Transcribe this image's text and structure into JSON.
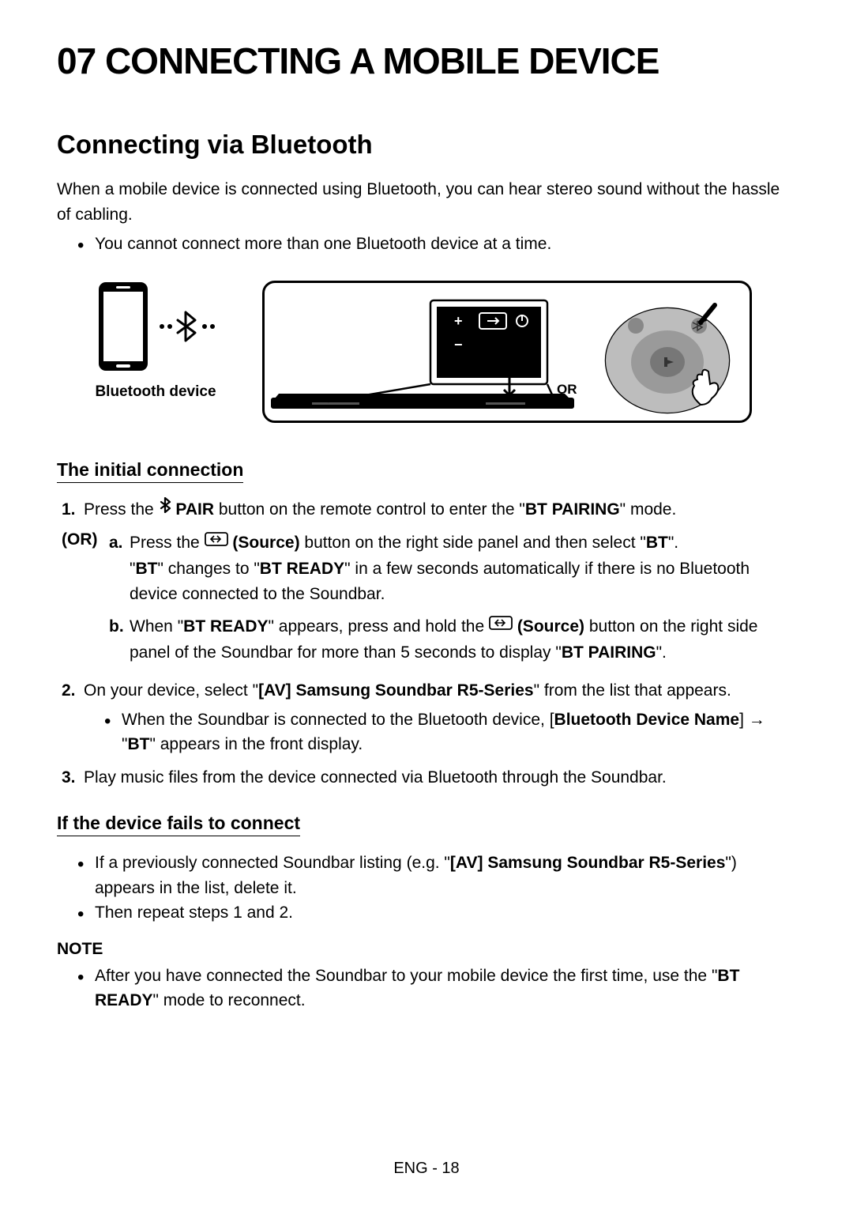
{
  "chapter": "07   CONNECTING A MOBILE DEVICE",
  "section": "Connecting via Bluetooth",
  "intro": "When a mobile device is connected using Bluetooth, you can hear stereo sound without the hassle of cabling.",
  "introBullet": "You cannot connect more than one Bluetooth device at a time.",
  "phoneLabel": "Bluetooth device",
  "orLabelDiagram": "OR",
  "initialConn": "The initial connection",
  "step1_a": "Press the ",
  "step1_pair": " PAIR",
  "step1_b": " button on the remote control to enter the \"",
  "step1_bold": "BT PAIRING",
  "step1_c": "\" mode.",
  "orLabel": "(OR)",
  "subA_1": "Press the ",
  "subA_src": " (Source)",
  "subA_2": " button on the right side panel and then select \"",
  "subA_bt": "BT",
  "subA_3": "\".",
  "subA_line2a": "\"",
  "subA_line2b": "BT",
  "subA_line2c": "\" changes to \"",
  "subA_line2d": "BT READY",
  "subA_line2e": "\" in a few seconds automatically if there is no Bluetooth device connected to the Soundbar.",
  "subB_1": "When \"",
  "subB_2": "BT READY",
  "subB_3": "\" appears, press and hold the ",
  "subB_src": " (Source)",
  "subB_4": " button on the right side panel of the Soundbar for more than 5 seconds to display \"",
  "subB_5": "BT PAIRING",
  "subB_6": "\".",
  "step2_a": "On your device, select \"",
  "step2_b": "[AV] Samsung Soundbar R5-Series",
  "step2_c": "\" from the list that appears.",
  "step2_bullet_a": "When the Soundbar is connected to the Bluetooth device, [",
  "step2_bullet_b": "Bluetooth Device Name",
  "step2_bullet_c": "] → \"",
  "step2_bullet_d": "BT",
  "step2_bullet_e": "\" appears in the front display.",
  "step3": "Play music files from the device connected via Bluetooth through the Soundbar.",
  "failsTitle": "If the device fails to connect",
  "fails1_a": "If a previously connected Soundbar listing (e.g. \"",
  "fails1_b": "[AV] Samsung Soundbar R5-Series",
  "fails1_c": "\") appears in the list, delete it.",
  "fails2": "Then repeat steps 1 and 2.",
  "noteLabel": "NOTE",
  "note_a": "After you have connected the Soundbar to your mobile device the first time, use the \"",
  "note_b": "BT READY",
  "note_c": "\" mode to reconnect.",
  "footer": "ENG - 18",
  "num1": "1.",
  "num2": "2.",
  "num3": "3.",
  "letA": "a.",
  "letB": "b."
}
